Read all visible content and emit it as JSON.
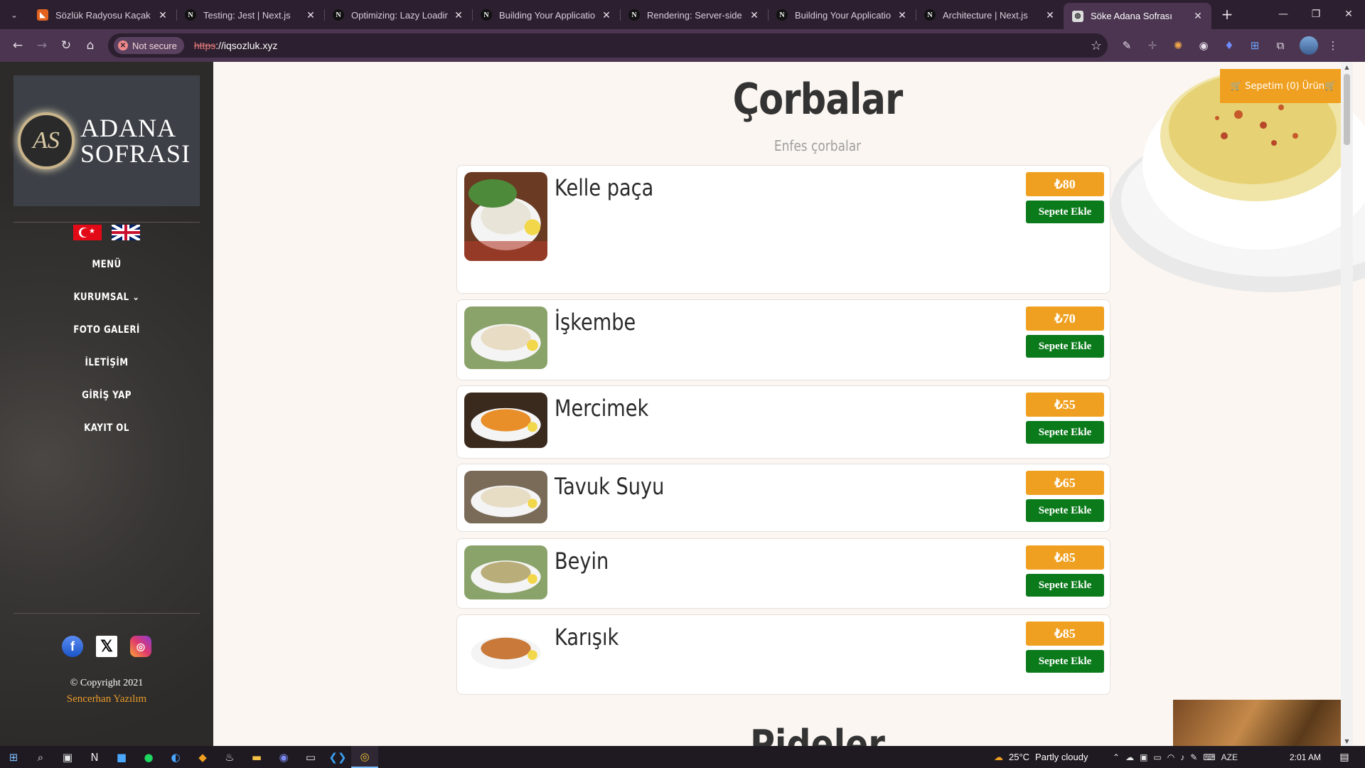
{
  "browser": {
    "tabs": [
      {
        "title": "Sözlük Radyosu Kaçak Yay",
        "favicon": "orange"
      },
      {
        "title": "Testing: Jest | Next.js",
        "favicon": "N"
      },
      {
        "title": "Optimizing: Lazy Loading",
        "favicon": "N"
      },
      {
        "title": "Building Your Application:",
        "favicon": "N"
      },
      {
        "title": "Rendering: Server-side Re",
        "favicon": "N"
      },
      {
        "title": "Building Your Application:",
        "favicon": "N"
      },
      {
        "title": "Architecture | Next.js",
        "favicon": "N"
      },
      {
        "title": "Söke Adana Sofrası",
        "favicon": "globe",
        "active": true
      }
    ],
    "security_label": "Not secure",
    "url_scheme": "https",
    "url_rest": "://iqsozluk.xyz"
  },
  "sidebar": {
    "logo_line1": "ADANA",
    "logo_line2": "SOFRASI",
    "logo_monogram": "AS",
    "nav": [
      {
        "label": "MENÜ",
        "name": "nav-menu"
      },
      {
        "label": "KURUMSAL ⌄",
        "name": "nav-kurumsal"
      },
      {
        "label": "FOTO GALERİ",
        "name": "nav-foto-galeri"
      },
      {
        "label": "İLETİŞİM",
        "name": "nav-iletisim"
      },
      {
        "label": "GİRİŞ YAP",
        "name": "nav-giris-yap"
      },
      {
        "label": "KAYIT OL",
        "name": "nav-kayit-ol"
      }
    ],
    "copyright": "© Copyright 2021",
    "author": "Sencerhan Yazılım"
  },
  "cart": {
    "label": "🛒 Sepetim (0) Ürün🛒"
  },
  "section": {
    "title": "Çorbalar",
    "subtitle": "Enfes çorbalar",
    "next_title": "Pideler"
  },
  "items": [
    {
      "name": "Kelle paça",
      "price": "₺80",
      "button": "Sepete Ekle",
      "soup": "#e8e4d8"
    },
    {
      "name": "İşkembe",
      "price": "₺70",
      "button": "Sepete Ekle",
      "soup": "#e9dcc4"
    },
    {
      "name": "Mercimek",
      "price": "₺55",
      "button": "Sepete Ekle",
      "soup": "#e88f2a"
    },
    {
      "name": "Tavuk Suyu",
      "price": "₺65",
      "button": "Sepete Ekle",
      "soup": "#e7dcc4"
    },
    {
      "name": "Beyin",
      "price": "₺85",
      "button": "Sepete Ekle",
      "soup": "#b9ae7a"
    },
    {
      "name": "Karışık",
      "price": "₺85",
      "button": "Sepete Ekle",
      "soup": "#c97a3a"
    }
  ],
  "taskbar": {
    "temperature": "25°C",
    "weather": "Partly cloudy",
    "lang": "AZE",
    "time": "2:01 AM"
  },
  "colors": {
    "accent_orange": "#f0a020",
    "add_green": "#0b7a1b",
    "author_orange": "#e89a2a"
  }
}
